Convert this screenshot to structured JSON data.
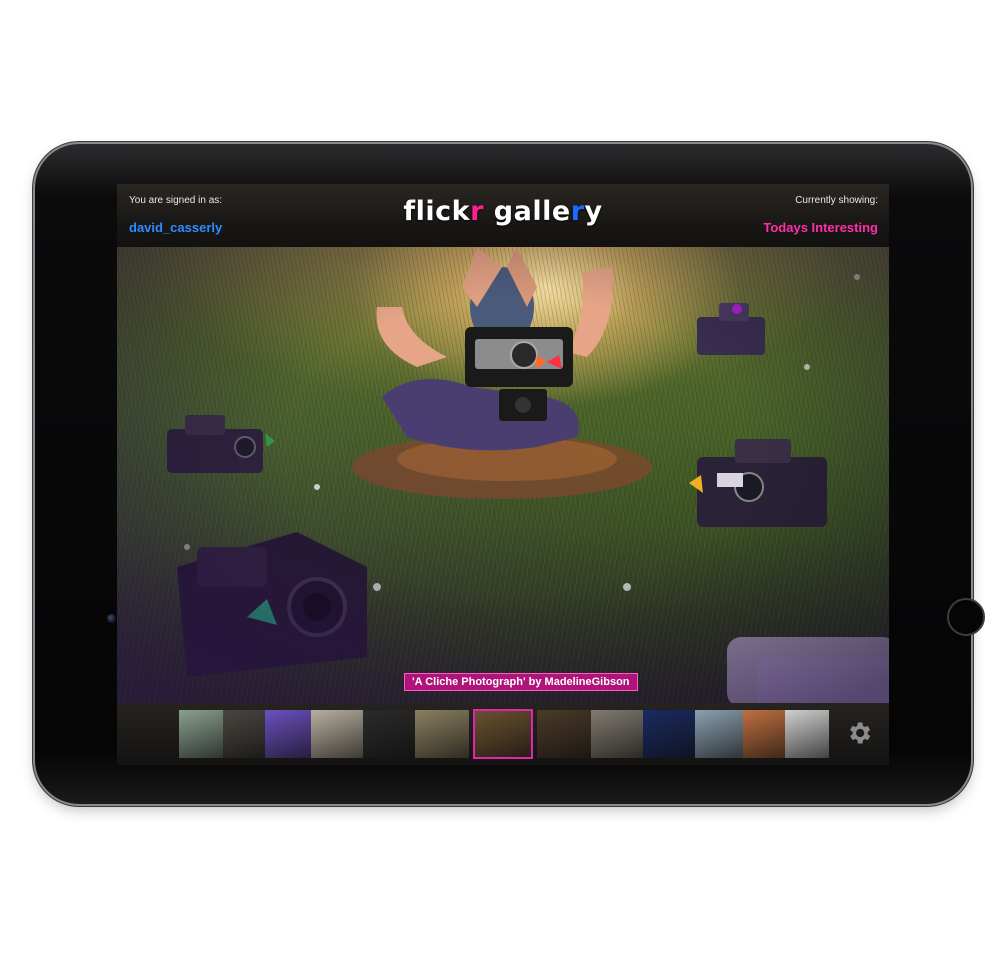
{
  "header": {
    "signed_in_label": "You are signed in as:",
    "username": "david_casserly",
    "logo_part1": "flick",
    "logo_r": "r",
    "logo_part2": " galle",
    "logo_r2": "r",
    "logo_part3": "y",
    "showing_label": "Currently showing:",
    "showing_value": "Todays Interesting"
  },
  "photo": {
    "caption": "'A Cliche Photograph' by MadelineGibson"
  },
  "thumbnails": [
    {
      "name": "thumb-bathroom",
      "color": "#8aa090"
    },
    {
      "name": "thumb-machine",
      "color": "#4a4540"
    },
    {
      "name": "thumb-lavender",
      "color": "#6a50c0"
    },
    {
      "name": "thumb-collage",
      "color": "#b8b0a0"
    },
    {
      "name": "thumb-dark-figure",
      "color": "#2a2a2a"
    },
    {
      "name": "thumb-landscape",
      "color": "#8a8060"
    },
    {
      "name": "thumb-cliche-photograph",
      "color": "#6a5030",
      "selected": true
    },
    {
      "name": "thumb-forest",
      "color": "#4a3a28"
    },
    {
      "name": "thumb-cars-street",
      "color": "#807a70"
    },
    {
      "name": "thumb-blue-car",
      "color": "#1a2a60"
    },
    {
      "name": "thumb-sea",
      "color": "#8aa0b0"
    },
    {
      "name": "thumb-canyon",
      "color": "#c07040"
    },
    {
      "name": "thumb-bw-portrait",
      "color": "#d0d0d0"
    }
  ],
  "colors": {
    "username": "#2d8cff",
    "showing_value": "#ff2fa8",
    "caption_bg": "#b0137a",
    "selection": "#e026b0"
  },
  "icons": {
    "settings": "gear-icon"
  }
}
